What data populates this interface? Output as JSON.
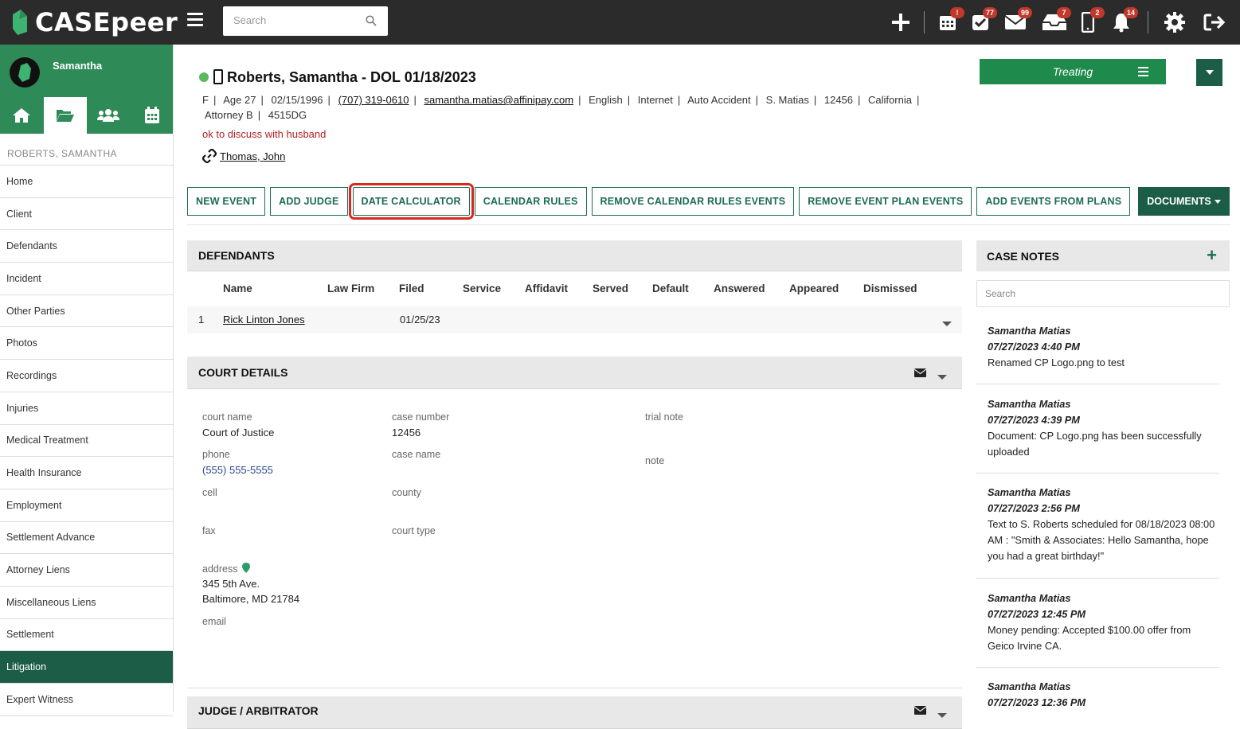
{
  "app": {
    "logo_text": "CASEpeer"
  },
  "topbar": {
    "search_placeholder": "Search",
    "badges": {
      "calendar": "!",
      "tasks": "77",
      "mail": "99",
      "inbox": "7",
      "phone": "2",
      "notifications": "14"
    }
  },
  "sidebar": {
    "user_name": "Samantha",
    "case_label": "ROBERTS, SAMANTHA",
    "items": [
      "Home",
      "Client",
      "Defendants",
      "Incident",
      "Other Parties",
      "Photos",
      "Recordings",
      "Injuries",
      "Medical Treatment",
      "Health Insurance",
      "Employment",
      "Settlement Advance",
      "Attorney Liens",
      "Miscellaneous Liens",
      "Settlement",
      "Litigation",
      "Expert Witness"
    ],
    "active_item": "Litigation"
  },
  "client": {
    "name": "Roberts, Samantha - DOL 01/18/2023",
    "gender": "F",
    "age": "Age 27",
    "dob": "02/15/1996",
    "phone": "(707) 319-0610",
    "email": "samantha.matias@affinipay.com",
    "language": "English",
    "source": "Internet",
    "case_type": "Auto Accident",
    "staff": "S. Matias",
    "zip": "12456",
    "state": "California",
    "attorney": "Attorney B",
    "code": "4515DG",
    "note": "ok to discuss with husband",
    "linked": "Thomas, John"
  },
  "status": {
    "label": "Treating"
  },
  "actions": [
    "NEW EVENT",
    "ADD JUDGE",
    "DATE CALCULATOR",
    "CALENDAR RULES",
    "REMOVE CALENDAR RULES EVENTS",
    "REMOVE EVENT PLAN EVENTS",
    "ADD EVENTS FROM PLANS"
  ],
  "documents_label": "DOCUMENTS",
  "defendants": {
    "title": "DEFENDANTS",
    "columns": [
      "Name",
      "Law Firm",
      "Filed",
      "Service",
      "Affidavit",
      "Served",
      "Default",
      "Answered",
      "Appeared",
      "Dismissed"
    ],
    "rows": [
      {
        "num": "1",
        "name": "Rick Linton Jones",
        "filed": "01/25/23"
      }
    ]
  },
  "court": {
    "title": "COURT DETAILS",
    "court_name_label": "court name",
    "court_name": "Court of Justice",
    "phone_label": "phone",
    "phone": "(555) 555-5555",
    "cell_label": "cell",
    "fax_label": "fax",
    "address_label": "address",
    "address1": "345 5th Ave.",
    "address2": "Baltimore, MD 21784",
    "email_label": "email",
    "case_number_label": "case number",
    "case_number": "12456",
    "case_name_label": "case name",
    "county_label": "county",
    "court_type_label": "court type",
    "trial_note_label": "trial note",
    "note_label": "note"
  },
  "judge": {
    "title": "JUDGE / ARBITRATOR"
  },
  "case_notes": {
    "title": "CASE NOTES",
    "search_placeholder": "Search",
    "notes": [
      {
        "author": "Samantha Matias",
        "time": "07/27/2023 4:40 PM",
        "text": "Renamed CP Logo.png to test"
      },
      {
        "author": "Samantha Matias",
        "time": "07/27/2023 4:39 PM",
        "text": "Document: CP Logo.png has been successfully uploaded"
      },
      {
        "author": "Samantha Matias",
        "time": "07/27/2023 2:56 PM",
        "text": "Text to S. Roberts scheduled for 08/18/2023 08:00 AM : \"Smith & Associates: Hello Samantha, hope you had a great birthday!\""
      },
      {
        "author": "Samantha Matias",
        "time": "07/27/2023 12:45 PM",
        "text": "Money pending: Accepted $100.00 offer from Geico Irvine CA."
      },
      {
        "author": "Samantha Matias",
        "time": "07/27/2023 12:36 PM",
        "text": ""
      }
    ]
  },
  "colors": {
    "brand_green": "#2e8b57",
    "dark_green": "#1c5d48",
    "topbar": "#2b2b2b",
    "badge_red": "#c0392b",
    "highlight_red": "#d9281e"
  }
}
